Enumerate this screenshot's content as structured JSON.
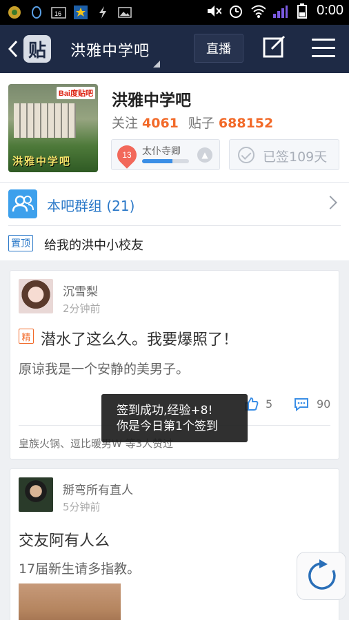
{
  "status_bar": {
    "time": "0:00"
  },
  "nav": {
    "logo_char": "贴",
    "title": "洪雅中学吧",
    "live_label": "直播"
  },
  "forum": {
    "name": "洪雅中学吧",
    "avatar_badge": "Bai度贴吧",
    "avatar_text": "洪雅中学吧",
    "followers_label": "关注",
    "followers": "4061",
    "posts_label": "贴子",
    "posts": "688152",
    "level": "13",
    "level_title": "太仆寺卿",
    "level_progress": 0.65,
    "signed_label": "已签109天"
  },
  "group_row": {
    "label": "本吧群组 (21)"
  },
  "top_post": {
    "tag": "置顶",
    "text": "给我的洪中小校友"
  },
  "posts": [
    {
      "author": "沉雪梨",
      "time": "2分钟前",
      "badge": "精",
      "title": "潜水了这么久。我要爆照了！",
      "body": "原谅我是一个安静的美男子。",
      "likes": "5",
      "comments": "90",
      "fans_line": "皇族火锅、逗比暖男W 等3人赞过"
    },
    {
      "author": "掰弯所有直人",
      "time": "5分钟前",
      "title": "交友阿有人么",
      "body": "17届新生请多指教。"
    }
  ],
  "toast": {
    "line1": "签到成功,经验+8!",
    "line2": "你是今日第1个签到"
  },
  "colors": {
    "nav_bg": "#1e2a45",
    "accent_orange": "#f26a29",
    "accent_blue": "#2a78c8"
  }
}
